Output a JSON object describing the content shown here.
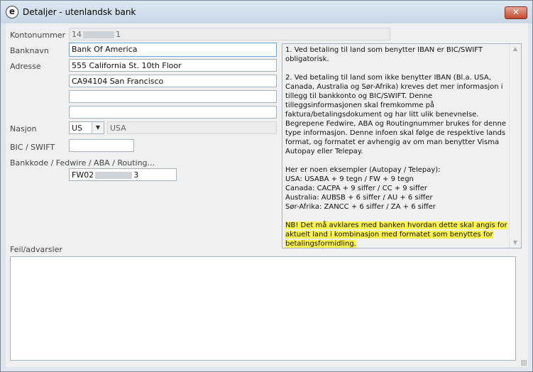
{
  "window": {
    "title": "Detaljer - utenlandsk bank",
    "close_symbol": "✕",
    "app_icon_letter": "e"
  },
  "form": {
    "kontonummer": {
      "label": "Kontonummer",
      "value_prefix": "14",
      "value_suffix": "1"
    },
    "banknavn": {
      "label": "Banknavn",
      "value": "Bank Of America"
    },
    "adresse": {
      "label": "Adresse",
      "lines": [
        "555 California St. 10th Floor",
        "CA94104 San Francisco",
        "",
        ""
      ]
    },
    "nasjon": {
      "label": "Nasjon",
      "code": "US",
      "name": "USA"
    },
    "bic": {
      "label": "BIC / SWIFT",
      "value": ""
    },
    "bankkode": {
      "label": "Bankkode / Fedwire / ABA / Routing...",
      "value_prefix": "FW02",
      "value_suffix": "3"
    },
    "feil": {
      "label": "Feil/advarsler",
      "value": ""
    }
  },
  "info": {
    "p1": "1. Ved betaling til land som benytter IBAN er BIC/SWIFT obligatorisk.",
    "p2": "2. Ved betaling til land som ikke benytter IBAN (Bl.a. USA, Canada, Australia og Sør-Afrika) kreves det mer informasjon i tillegg til bankkonto og BIC/SWIFT. Denne tilleggsinformasjonen skal fremkomme på faktura/betalingsdokument og har litt ulik benevnelse. Begrepene Fedwire, ABA og Routingnummer brukes for denne type informasjon. Denne infoen skal følge de respektive lands format, og formatet er avhengig av om man benytter Visma Autopay eller Telepay.",
    "examples_heading": "Her er noen eksempler (Autopay / Telepay):",
    "examples": [
      "USA: USABA + 9 tegn / FW + 9 tegn",
      "Canada: CACPA + 9 siffer / CC + 9 siffer",
      "Australia: AUBSB + 6 siffer / AU + 6 siffer",
      "Sør-Afrika: ZANCC + 6 siffer / ZA + 6 siffer"
    ],
    "note": "NB! Det må avklares med banken hvordan dette skal angis for aktuelt land i kombinasjon med formatet som benyttes for betalingsformidling."
  }
}
